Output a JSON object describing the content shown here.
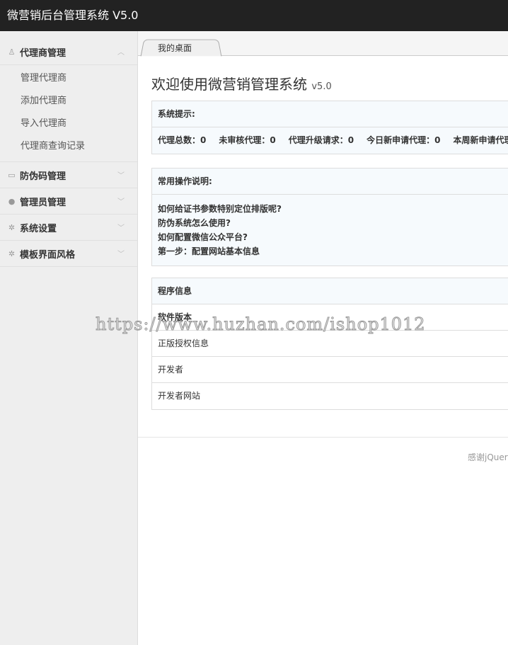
{
  "header": {
    "title": "微营销后台管理系统 V5.0"
  },
  "sidebar": {
    "groups": [
      {
        "label": "代理商管理",
        "icon": "user-outline-icon",
        "expanded": true,
        "items": [
          "管理代理商",
          "添加代理商",
          "导入代理商",
          "代理商查询记录"
        ]
      },
      {
        "label": "防伪码管理",
        "icon": "image-icon"
      },
      {
        "label": "管理员管理",
        "icon": "user-icon"
      },
      {
        "label": "系统设置",
        "icon": "gear-icon"
      },
      {
        "label": "模板界面风格",
        "icon": "gear-icon"
      }
    ]
  },
  "tabs": [
    {
      "label": "我的桌面"
    }
  ],
  "main": {
    "title": "欢迎使用微营销管理系统",
    "version": "v5.0",
    "system_tips": {
      "heading": "系统提示:",
      "stats": [
        "代理总数：0",
        "未审核代理：0",
        "代理升级请求：0",
        "今日新申请代理：0",
        "本周新申请代理"
      ]
    },
    "help": {
      "heading": "常用操作说明:",
      "items": [
        "如何给证书参数特别定位排版呢?",
        "防伪系统怎么使用?",
        "如何配置微信公众平台?",
        "第一步：配置网站基本信息"
      ]
    },
    "program_info": {
      "heading": "程序信息",
      "rows": [
        "软件版本",
        "正版授权信息",
        "开发者",
        "开发者网站"
      ]
    }
  },
  "footer": {
    "text": "感谢jQuery"
  },
  "watermark": "https://www.huzhan.com/ishop1012"
}
